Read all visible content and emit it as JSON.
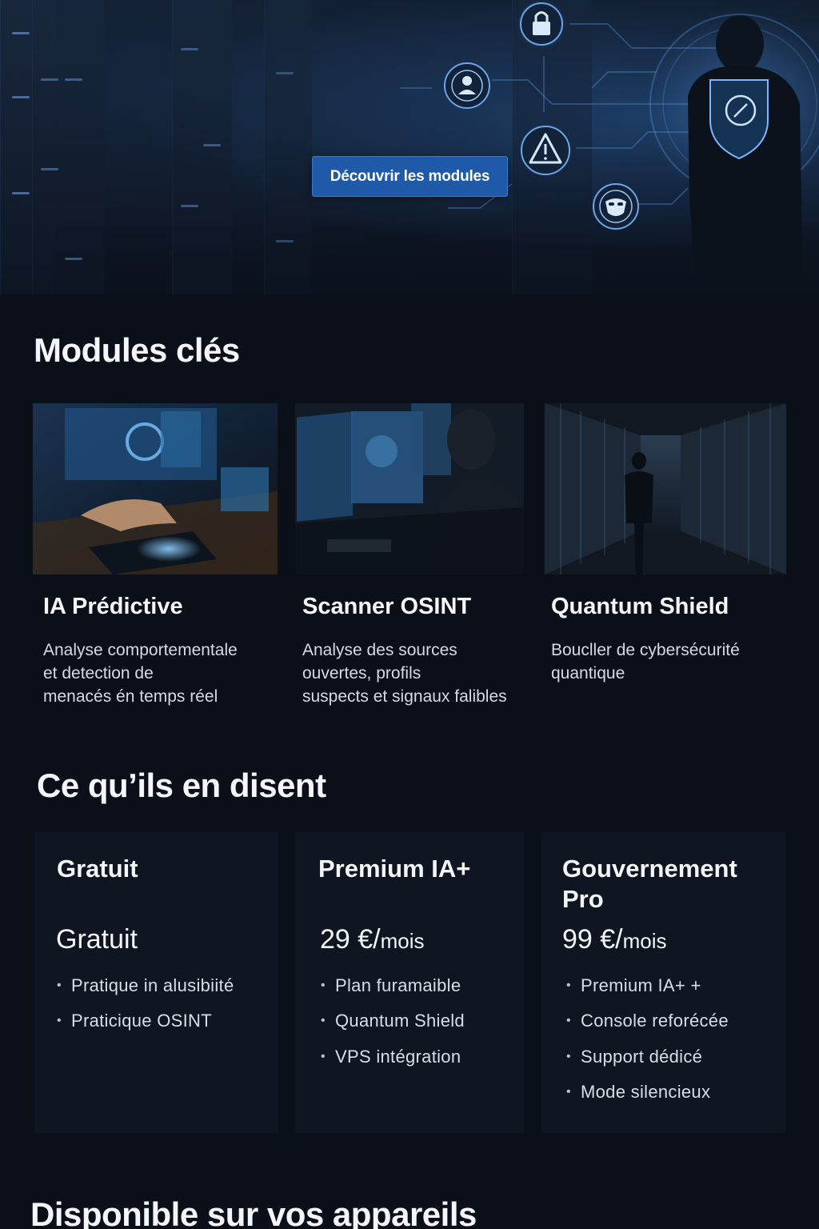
{
  "hero": {
    "cta_label": "Découvrir les modules"
  },
  "modules": {
    "title": "Modules clés",
    "items": [
      {
        "title": "IA Prédictive",
        "desc_lines": [
          "Analyse comportementale",
          "et detection de",
          "menacés én temps réel"
        ]
      },
      {
        "title": "Scanner OSINT",
        "desc_lines": [
          "Analyse des sources",
          "ouvertes, profils",
          "suspects et signaux falibles"
        ]
      },
      {
        "title": "Quantum Shield",
        "desc_lines": [
          "Boucller de cybersécurité",
          "quantique"
        ]
      }
    ]
  },
  "testimonials": {
    "title": "Ce qu’ils en disent",
    "plans": [
      {
        "name_lines": [
          "Gratuit"
        ],
        "price": "Gratuit",
        "per": "",
        "features": [
          "Pratique in alusibiité",
          "Praticique  OSINT"
        ]
      },
      {
        "name_lines": [
          "Premium IA+"
        ],
        "price": "29 €/",
        "per": "mois",
        "features": [
          "Plan furamaible",
          "Quantum Shield",
          "VPS intégration"
        ]
      },
      {
        "name_lines": [
          "Gouvernement",
          "Pro"
        ],
        "price": "99 €/",
        "per": "mois",
        "features": [
          "Premium IA+ +",
          "Console reforécée",
          "Support dédicé",
          "Mode silencieux"
        ]
      }
    ]
  },
  "devices": {
    "title": "Disponible sur vos appareils"
  },
  "colors": {
    "background": "#0a0f18",
    "card": "#0f1621",
    "accent": "#1f5aa8"
  },
  "icons": [
    "lock-icon",
    "user-icon",
    "warning-icon",
    "shield-icon",
    "mask-icon"
  ]
}
